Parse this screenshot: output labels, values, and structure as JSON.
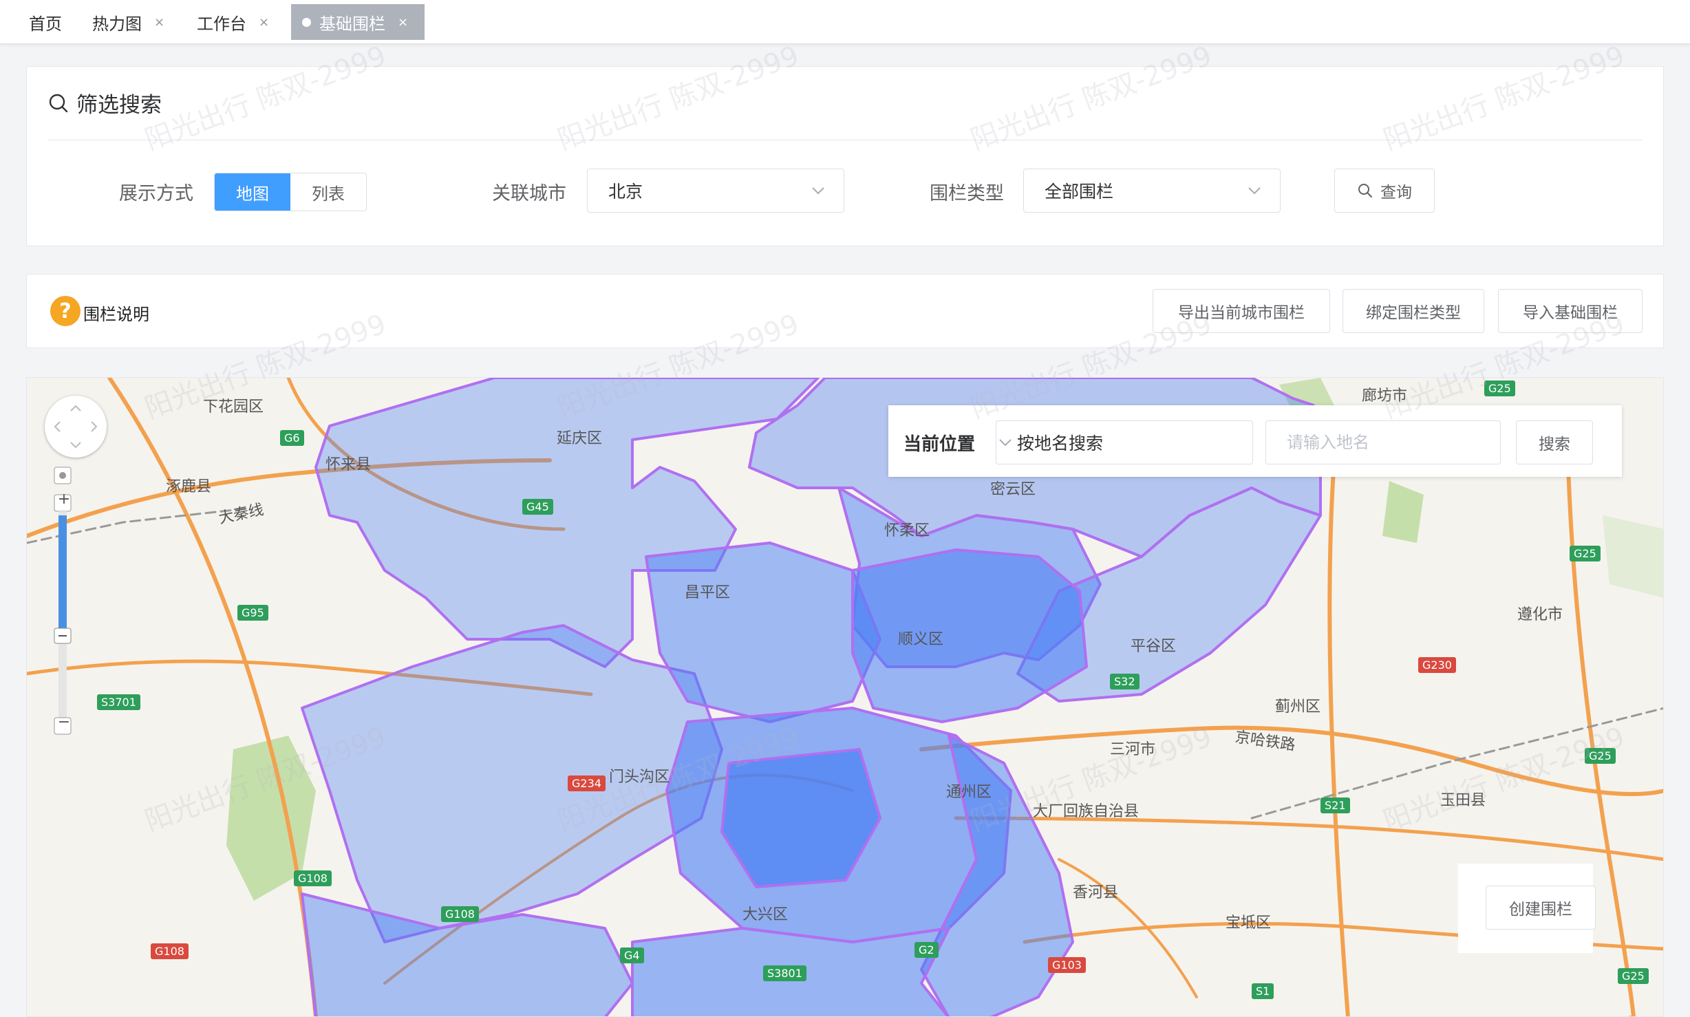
{
  "tabs": [
    {
      "label": "首页",
      "closable": false,
      "active": false
    },
    {
      "label": "热力图",
      "closable": true,
      "active": false
    },
    {
      "label": "工作台",
      "closable": true,
      "active": false
    },
    {
      "label": "基础围栏",
      "closable": true,
      "active": true
    }
  ],
  "tab_close_glyph": "×",
  "filter": {
    "title": "筛选搜索",
    "display_label": "展示方式",
    "display_options": [
      "地图",
      "列表"
    ],
    "display_selected": "地图",
    "city_label": "关联城市",
    "city_value": "北京",
    "fence_type_label": "围栏类型",
    "fence_type_value": "全部围栏",
    "query_button": "查询"
  },
  "actions": {
    "help_icon_glyph": "?",
    "help_label": "围栏说明",
    "export_button": "导出当前城市围栏",
    "bind_button": "绑定围栏类型",
    "import_button": "导入基础围栏"
  },
  "map": {
    "current_location_label": "当前位置",
    "search_mode_value": "按地名搜索",
    "place_input_placeholder": "请输入地名",
    "search_button": "搜索",
    "create_fence_button": "创建围栏",
    "zoom_in_glyph": "+",
    "zoom_out_glyph": "−",
    "place_labels": [
      "下花园区",
      "怀来县",
      "涿鹿县",
      "大秦线",
      "延庆区",
      "密云区",
      "怀柔区",
      "昌平区",
      "顺义区",
      "平谷区",
      "蓟州区",
      "遵化市",
      "三河市",
      "门头沟区",
      "通州区",
      "大厂回族自治县",
      "香河县",
      "玉田县",
      "宝坻区",
      "京哈铁路",
      "大兴区",
      "廊坊市"
    ],
    "road_shields": [
      "G6",
      "G95",
      "S3701",
      "G234",
      "G108",
      "G108",
      "G108",
      "G25",
      "G25",
      "G25",
      "G25",
      "G230",
      "S32",
      "S21",
      "G103",
      "S1",
      "G4",
      "S3801",
      "G2",
      "G45"
    ],
    "colors": {
      "fence_fill": "#4a7ff5",
      "fence_stroke": "#b070f0",
      "accent": "#409eff"
    }
  },
  "watermark_text": "阳光出行 陈双-2999"
}
